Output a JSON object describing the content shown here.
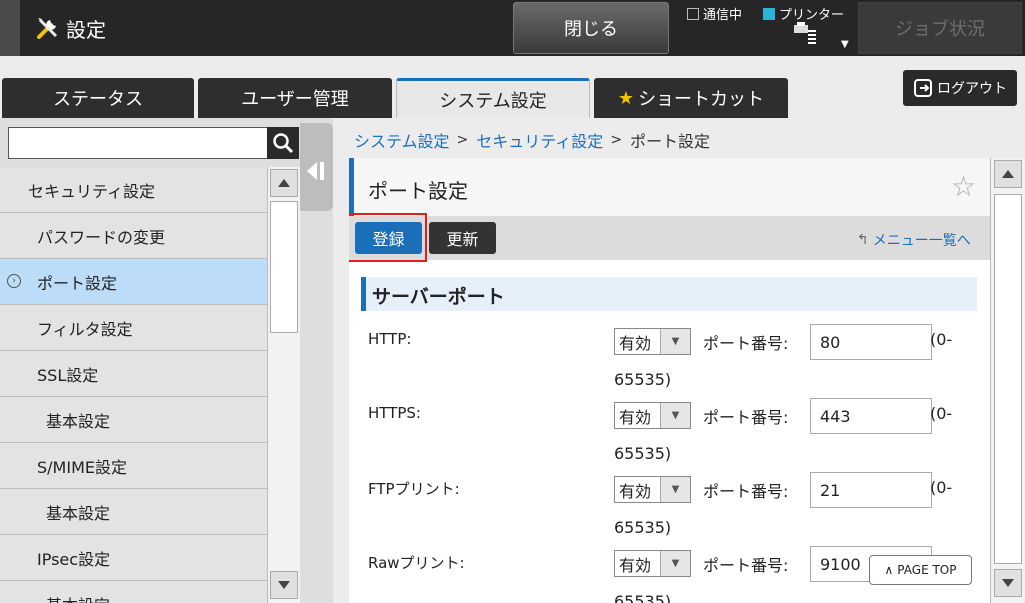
{
  "header": {
    "title": "設定",
    "close_label": "閉じる",
    "status_comm": "通信中",
    "status_printer": "プリンター",
    "job_status_label": "ジョブ状況",
    "accent_color": "#29b3d6"
  },
  "tabs": [
    {
      "label": "ステータス"
    },
    {
      "label": "ユーザー管理"
    },
    {
      "label": "システム設定",
      "active": true
    },
    {
      "label": "ショートカット"
    }
  ],
  "logout_label": "ログアウト",
  "search": {
    "value": "",
    "placeholder": ""
  },
  "nav": {
    "items": [
      {
        "label": "セキュリティ設定"
      },
      {
        "label": "パスワードの変更"
      },
      {
        "label": "ポート設定",
        "active": true
      },
      {
        "label": "フィルタ設定"
      },
      {
        "label": "SSL設定"
      },
      {
        "label": "基本設定"
      },
      {
        "label": "S/MIME設定"
      },
      {
        "label": "基本設定"
      },
      {
        "label": "IPsec設定"
      },
      {
        "label": "基本設定"
      }
    ]
  },
  "breadcrumb": {
    "items": [
      "システム設定",
      "セキュリティ設定",
      "ポート設定"
    ],
    "separator": ">"
  },
  "page": {
    "title": "ポート設定",
    "register_label": "登録",
    "update_label": "更新",
    "menu_link": "メニュー一覧へ"
  },
  "section": {
    "title": "サーバーポート",
    "port_label": "ポート番号:",
    "range_open": "(0-",
    "range_close": "65535)",
    "rows": [
      {
        "label": "HTTP:",
        "status": "有効",
        "port": "80"
      },
      {
        "label": "HTTPS:",
        "status": "有効",
        "port": "443"
      },
      {
        "label": "FTPプリント:",
        "status": "有効",
        "port": "21"
      },
      {
        "label": "Rawプリント:",
        "status": "有効",
        "port": "9100"
      }
    ]
  },
  "page_top_label": "PAGE TOP"
}
